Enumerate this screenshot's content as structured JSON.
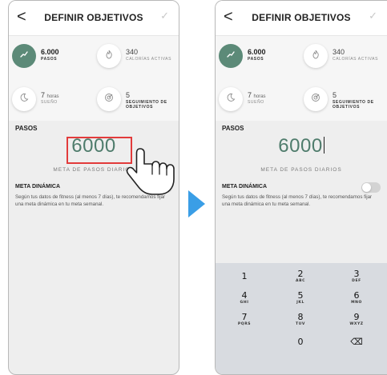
{
  "left_screen": {
    "header": {
      "back": "<",
      "title": "DEFINIR OBJETIVOS",
      "confirm": "✓"
    },
    "tiles": [
      {
        "value": "6.000",
        "label": "PASOS",
        "icon": "steps-icon",
        "active": true
      },
      {
        "value": "340",
        "label": "CALORÍAS ACTIVAS",
        "icon": "flame-icon",
        "active": false
      },
      {
        "value": "7",
        "unit": "horas",
        "label": "SUEÑO",
        "icon": "moon-icon",
        "active": false
      },
      {
        "value": "5",
        "label": "SEGUIMIENTO DE OBJETIVOS",
        "icon": "target-icon",
        "active": false
      }
    ],
    "section_label": "PASOS",
    "steps_value": "6000",
    "steps_caption": "META DE PASOS DIARIOS",
    "dynamic_label": "META DINÁMICA",
    "dynamic_description": "Según tus datos de fitness (al menos 7 días), te recomendamos fijar una meta dinámica en tu meta semanal."
  },
  "right_screen": {
    "header": {
      "back": "<",
      "title": "DEFINIR OBJETIVOS",
      "confirm": "✓"
    },
    "tiles": [
      {
        "value": "6.000",
        "label": "PASOS",
        "icon": "steps-icon",
        "active": true
      },
      {
        "value": "340",
        "label": "CALORÍAS ACTIVAS",
        "icon": "flame-icon",
        "active": false
      },
      {
        "value": "7",
        "unit": "horas",
        "label": "SUEÑO",
        "icon": "moon-icon",
        "active": false
      },
      {
        "value": "5",
        "label": "SEGUIMIENTO DE OBJETIVOS",
        "icon": "target-icon",
        "active": false
      }
    ],
    "section_label": "PASOS",
    "steps_value": "6000",
    "steps_caption": "META DE PASOS DIARIOS",
    "dynamic_label": "META DINÁMICA",
    "dynamic_description": "Según tus datos de fitness (al menos 7 días), te recomendamos fijar una meta dinámica en tu meta semanal."
  },
  "keyboard": {
    "keys": [
      {
        "digit": "1",
        "letters": ""
      },
      {
        "digit": "2",
        "letters": "ABC"
      },
      {
        "digit": "3",
        "letters": "DEF"
      },
      {
        "digit": "4",
        "letters": "GHI"
      },
      {
        "digit": "5",
        "letters": "JKL"
      },
      {
        "digit": "6",
        "letters": "MNO"
      },
      {
        "digit": "7",
        "letters": "PQRS"
      },
      {
        "digit": "8",
        "letters": "TUV"
      },
      {
        "digit": "9",
        "letters": "WXYZ"
      },
      {
        "digit": "",
        "letters": ""
      },
      {
        "digit": "0",
        "letters": ""
      },
      {
        "digit": "⌫",
        "letters": ""
      }
    ]
  },
  "colors": {
    "accent": "#5c8a78",
    "highlight": "#e23b3b",
    "arrow": "#3a9ee6"
  }
}
